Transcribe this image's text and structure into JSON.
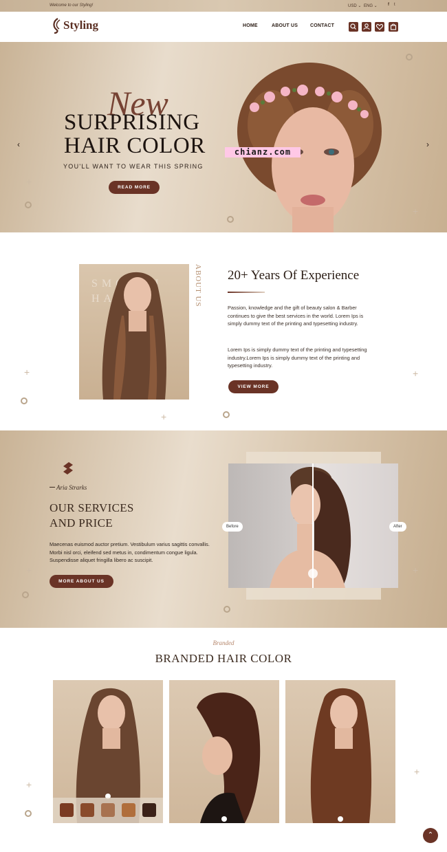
{
  "topbar": {
    "welcome": "Welcome to our Styling!",
    "currency": "USD ⌄",
    "language": "ENG ⌄",
    "facebook_icon": "f",
    "twitter_icon": "t"
  },
  "header": {
    "logo": "Styling",
    "nav": [
      "HOME",
      "ABOUT US",
      "CONTACT"
    ]
  },
  "hero": {
    "script": "New",
    "title_line1": "SURPRISING",
    "title_line2": "HAIR COLOR",
    "subtitle": "YOU'LL WANT TO WEAR THIS SPRING",
    "button": "READ MORE",
    "watermark": "chianz.com",
    "prev": "‹",
    "next": "›"
  },
  "about": {
    "image_text": "SMOOTH HAIR",
    "vertical_label": "ABOUT US",
    "title": "20+ Years Of Experience",
    "p1": "Passion, knowledge and the gift of beauty salon & Barber continues to give the best services in the world. Lorem Ips is simply dummy text of the printing and typesetting industry.",
    "p2": "Lorem Ips is simply dummy text of the printing and typesetting industry.Lorem Ips is simply dummy text of the printing and typesetting industry.",
    "button": "VIEW MORE"
  },
  "services": {
    "author": "Aria Strarks",
    "title_line1": "OUR SERVICES",
    "title_line2": "AND PRICE",
    "text": "Maecenas euismod auctor pretium. Vestibulum varius sagittis convallis. Morbi nisl orci, eleifend sed metus in, condimentum congue ligula. Suspendisse aliquet fringilla libero ac suscipit.",
    "button": "MORE ABOUT US",
    "before_label": "Before",
    "after_label": "After"
  },
  "branded": {
    "script": "Branded",
    "title": "BRANDED HAIR COLOR",
    "swatch_colors": [
      "#7a3b22",
      "#8a4b2c",
      "#a87250",
      "#b06e3c",
      "#3b2218"
    ]
  },
  "colors": {
    "accent": "#6a3326",
    "sand": "#d8c6ae"
  }
}
